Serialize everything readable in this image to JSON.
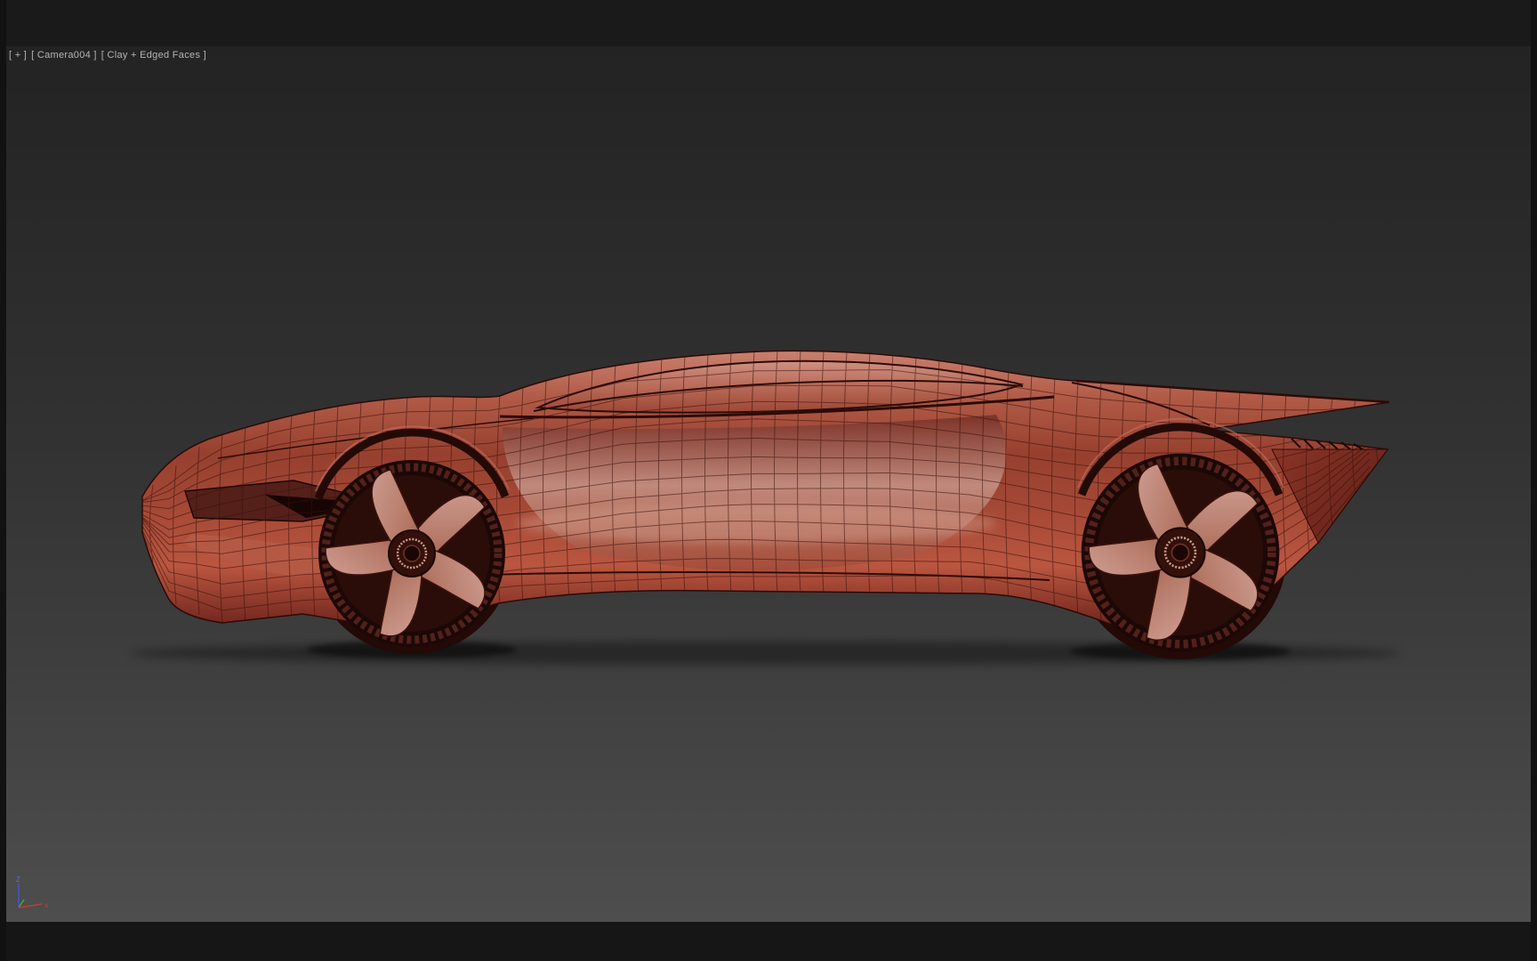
{
  "viewport": {
    "label_menu": "[ + ]",
    "label_camera": "[ Camera004 ]",
    "label_shading": "[ Clay + Edged Faces ]",
    "shading_mode": "Clay + Edged Faces",
    "camera_name": "Camera004"
  },
  "axis": {
    "x_label": "x",
    "z_label": "Z"
  },
  "scene": {
    "description": "Clay-shaded concept sports car 3D model with edged-face wireframe, side view"
  },
  "colors": {
    "background_top": "#232323",
    "background_bottom": "#4e4e4e",
    "chrome_black": "#1a1a1a",
    "body_clay_red": "#a84a38",
    "body_highlight": "#d0a093",
    "wireframe_edge": "#38100b",
    "label_text": "#b5b5b5",
    "axis_x_red": "#c03c34",
    "axis_y_green": "#3fae3f",
    "axis_z_blue": "#5a6cdb"
  }
}
